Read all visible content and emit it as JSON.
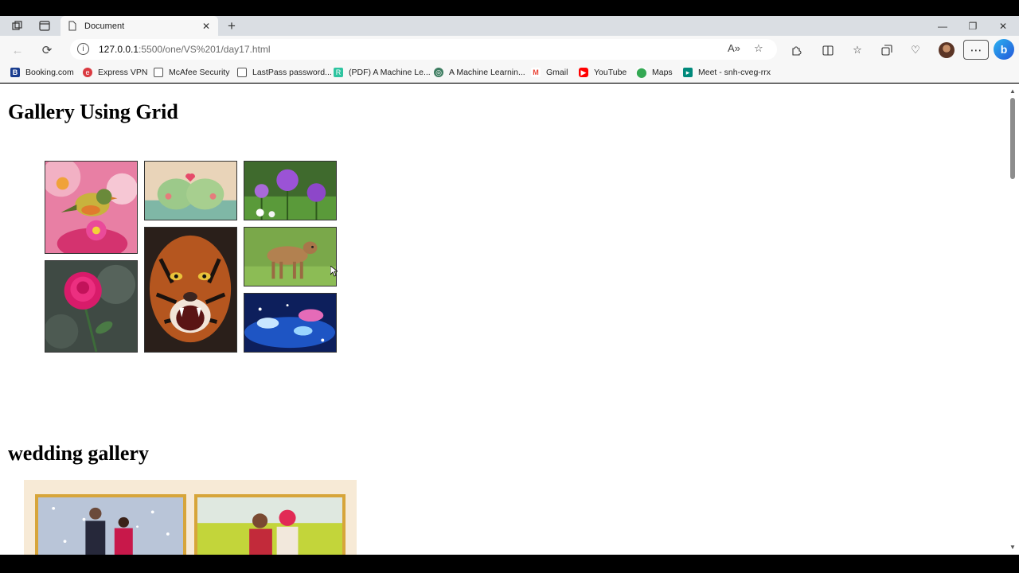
{
  "browser": {
    "tab_title": "Document",
    "tab_close": "✕",
    "new_tab": "+",
    "url_host": "127.0.0.1",
    "url_path": ":5500/one/VS%201/day17.html",
    "window_controls": {
      "minimize": "—",
      "restore": "❐",
      "close": "✕"
    },
    "more": "⋯",
    "copilot": "b"
  },
  "bookmarks": [
    {
      "label": "Booking.com",
      "icon": "booking-icon",
      "color": "#1a3d8f"
    },
    {
      "label": "Express VPN",
      "icon": "expressvpn-icon",
      "color": "#da3940"
    },
    {
      "label": "McAfee Security",
      "icon": "page-icon",
      "color": "#ffffff"
    },
    {
      "label": "LastPass password...",
      "icon": "page-icon",
      "color": "#ffffff"
    },
    {
      "label": "(PDF) A Machine Le...",
      "icon": "researchgate-icon",
      "color": "#2ec4a0"
    },
    {
      "label": "A Machine Learnin...",
      "icon": "globe-icon",
      "color": "#3c7c60"
    },
    {
      "label": "Gmail",
      "icon": "gmail-icon",
      "color": "#ea4335"
    },
    {
      "label": "YouTube",
      "icon": "youtube-icon",
      "color": "#ff0000"
    },
    {
      "label": "Maps",
      "icon": "maps-pin-icon",
      "color": "#34a853"
    },
    {
      "label": "Meet - snh-cveg-rrx",
      "icon": "meet-icon",
      "color": "#00897b"
    }
  ],
  "page": {
    "heading_1": "Gallery Using Grid",
    "heading_2": "wedding gallery"
  },
  "gallery": [
    {
      "name": "bird-on-flower-image",
      "subject": "bird on flowers"
    },
    {
      "name": "kissing-birds-image",
      "subject": "two birds kissing"
    },
    {
      "name": "purple-alliums-image",
      "subject": "purple allium flowers"
    },
    {
      "name": "tiger-roaring-image",
      "subject": "roaring tiger"
    },
    {
      "name": "calf-on-grass-image",
      "subject": "calf on grass"
    },
    {
      "name": "pink-rose-image",
      "subject": "pink rose"
    },
    {
      "name": "glowing-fish-image",
      "subject": "glowing fish"
    }
  ],
  "wedding_gallery": [
    {
      "name": "couple-in-snow-image",
      "subject": "couple in snow"
    },
    {
      "name": "couple-in-field-image",
      "subject": "couple in mustard field"
    }
  ]
}
